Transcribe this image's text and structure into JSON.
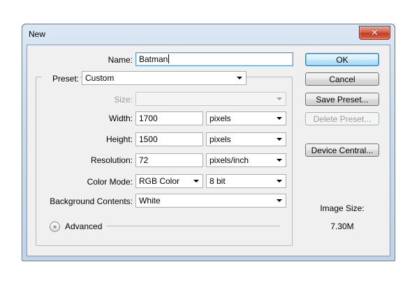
{
  "window": {
    "title": "New",
    "close_glyph": "✕"
  },
  "form": {
    "name": {
      "label": "Name:",
      "value": "Batman"
    },
    "preset": {
      "label": "Preset:",
      "value": "Custom"
    },
    "size": {
      "label": "Size:",
      "value": "",
      "disabled": true
    },
    "width": {
      "label": "Width:",
      "value": "1700",
      "unit": "pixels"
    },
    "height": {
      "label": "Height:",
      "value": "1500",
      "unit": "pixels"
    },
    "resolution": {
      "label": "Resolution:",
      "value": "72",
      "unit": "pixels/inch"
    },
    "color_mode": {
      "label": "Color Mode:",
      "value": "RGB Color",
      "depth": "8 bit"
    },
    "background": {
      "label": "Background Contents:",
      "value": "White"
    },
    "advanced": {
      "label": "Advanced",
      "icon": "chevron-double-down-icon"
    }
  },
  "buttons": {
    "ok": "OK",
    "cancel": "Cancel",
    "save_preset": "Save Preset...",
    "delete_preset": "Delete Preset...",
    "device_central": "Device Central..."
  },
  "image_size": {
    "label": "Image Size:",
    "value": "7.30M"
  },
  "colors": {
    "accent": "#3c7fb1",
    "close": "#c23c22",
    "dialog_bg": "#f0f0f0"
  }
}
